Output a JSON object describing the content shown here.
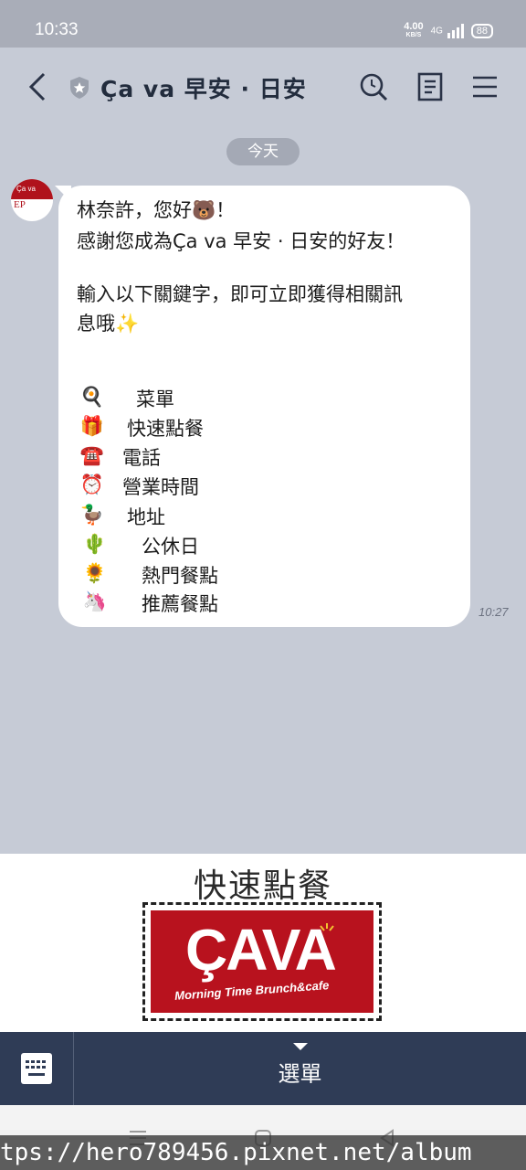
{
  "status_bar": {
    "time": "10:33",
    "net_speed_value": "4.00",
    "net_speed_unit": "KB/S",
    "signal": "4G",
    "battery": "88"
  },
  "header": {
    "title": "Ça va 早安 · 日安"
  },
  "chat": {
    "date_chip": "今天",
    "avatar_text": "Ça va",
    "avatar_sub": "EP",
    "message": {
      "line1": "林奈許，您好",
      "line1_emoji": "🐻",
      "line1_end": "！",
      "line2": "感謝您成為Ça va 早安 · 日安的好友！",
      "line3": "輸入以下關鍵字，即可立即獲得相關訊",
      "line4": "息哦",
      "line4_emoji": "✨"
    },
    "keywords": [
      {
        "emoji": "🍳",
        "label": "菜單"
      },
      {
        "emoji": "🎁",
        "label": "快速點餐"
      },
      {
        "emoji": "☎️",
        "label": "電話"
      },
      {
        "emoji": "⏰",
        "label": "營業時間"
      },
      {
        "emoji": "🦆",
        "label": "地址"
      },
      {
        "emoji": "🌵",
        "label": "公休日"
      },
      {
        "emoji": "🌻",
        "label": "熱門餐點"
      },
      {
        "emoji": "🦄",
        "label": "推薦餐點"
      }
    ],
    "time": "10:27"
  },
  "rich_menu": {
    "title": "快速點餐",
    "logo_text": "ÇAVA",
    "logo_sub": "Morning Time Brunch&cafe"
  },
  "bottom_bar": {
    "menu_label": "選單"
  },
  "watermark": "tps://hero789456.pixnet.net/album",
  "icons": {
    "back": "back-arrow-icon",
    "search": "search-icon",
    "notes": "notes-icon",
    "menu": "hamburger-icon",
    "keyboard": "keyboard-icon"
  },
  "colors": {
    "chat_background": "#c6cbd6",
    "bottom_bar": "#2f3c56",
    "logo_red": "#b8121e"
  }
}
